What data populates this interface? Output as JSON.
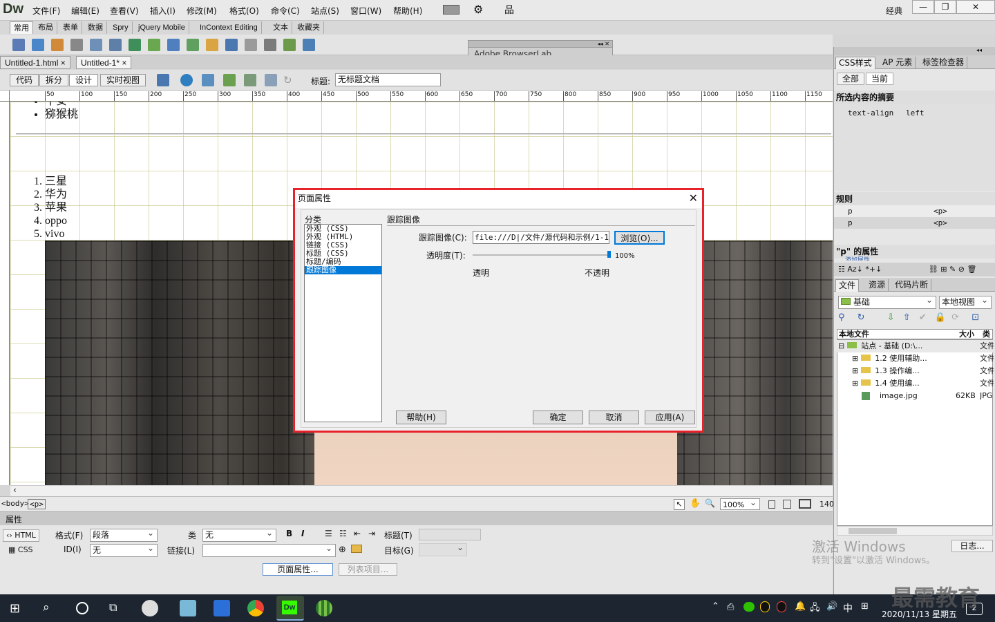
{
  "app": {
    "logo": "Dw"
  },
  "menu": [
    "文件(F)",
    "编辑(E)",
    "查看(V)",
    "插入(I)",
    "修改(M)",
    "格式(O)",
    "命令(C)",
    "站点(S)",
    "窗口(W)",
    "帮助(H)"
  ],
  "workspace": "经典",
  "window_controls": {
    "minimize": "—",
    "restore": "❐",
    "close": "✕"
  },
  "insert_tabs": [
    "常用",
    "布局",
    "表单",
    "数据",
    "Spry",
    "jQuery Mobile",
    "InContext Editing",
    "文本",
    "收藏夹"
  ],
  "browserlab": {
    "title": "Adobe BrowserLab"
  },
  "doc_tabs": [
    {
      "label": "Untitled-1.html"
    },
    {
      "label": "Untitled-1*"
    }
  ],
  "tab_close": "×",
  "view_buttons": [
    "代码",
    "拆分",
    "设计",
    "实时视图"
  ],
  "doc_title": {
    "label": "标题:",
    "value": "无标题文档"
  },
  "ruler_ticks": [
    "50",
    "100",
    "150",
    "200",
    "250",
    "300",
    "350",
    "400",
    "450",
    "500",
    "550",
    "600",
    "650",
    "700",
    "750",
    "800",
    "850",
    "900",
    "950",
    "1000",
    "1050",
    "1100",
    "1150"
  ],
  "canvas": {
    "ul_items": [
      "平安",
      "猕猴桃"
    ],
    "ol_items": [
      "三星",
      "华为",
      "苹果",
      "oppo",
      "vivo"
    ]
  },
  "statusbar": {
    "tags": [
      "<body>",
      "<p>"
    ],
    "zoom": "100%",
    "size": "140"
  },
  "properties": {
    "title": "属性",
    "html_btn": "HTML",
    "css_btn": "CSS",
    "format_label": "格式(F)",
    "format_value": "段落",
    "class_label": "类",
    "class_value": "无",
    "id_label": "ID(I)",
    "id_value": "无",
    "link_label": "链接(L)",
    "title_label": "标题(T)",
    "target_label": "目标(G)",
    "bold": "B",
    "italic": "I",
    "page_props_btn": "页面属性...",
    "list_item_btn": "列表项目..."
  },
  "right_panel": {
    "tabs1": [
      "CSS样式",
      "AP 元素",
      "标签检查器"
    ],
    "mode_tabs": [
      "全部",
      "当前"
    ],
    "summary_title": "所选内容的摘要",
    "summary_prop": "text-align",
    "summary_value": "left",
    "rules_title": "规则",
    "rules": [
      {
        "sel": "p",
        "tag": "<p>"
      },
      {
        "sel": "p",
        "tag": "<p>"
      }
    ],
    "props_title": "\"p\" 的属性",
    "add_prop": "添加属性",
    "tabs2": [
      "文件",
      "资源",
      "代码片断"
    ],
    "site": "基础",
    "view": "本地视图",
    "cols": [
      "本地文件",
      "大小",
      "类型"
    ],
    "files": [
      {
        "name": "站点 - 基础 (D:\\...",
        "size": "",
        "type": "文件"
      },
      {
        "name": "1.2 使用辅助...",
        "size": "",
        "type": "文件"
      },
      {
        "name": "1.3  操作编...",
        "size": "",
        "type": "文件"
      },
      {
        "name": "1.4  使用编...",
        "size": "",
        "type": "文件"
      },
      {
        "name": "image.jpg",
        "size": "62KB",
        "type": "JPG"
      }
    ],
    "log_btn": "日志..."
  },
  "dialog": {
    "title": "页面属性",
    "category_label": "分类",
    "categories": [
      "外观 (CSS)",
      "外观 (HTML)",
      "链接 (CSS)",
      "标题 (CSS)",
      "标题/编码",
      "跟踪图像"
    ],
    "section_title": "跟踪图像",
    "image_label": "跟踪图像(C):",
    "image_value": "file:///D|/文件/源代码和示例/1-1",
    "browse_btn": "浏览(O)...",
    "opacity_label": "透明度(T):",
    "opacity_value": "100%",
    "opacity_level": 1.0,
    "transparent": "透明",
    "opaque": "不透明",
    "help_btn": "帮助(H)",
    "ok_btn": "确定",
    "cancel_btn": "取消",
    "apply_btn": "应用(A)"
  },
  "watermark": {
    "line1": "激活 Windows",
    "line2": "转到\"设置\"以激活 Windows。"
  },
  "brand": "最需教育",
  "taskbar": {
    "ime": "中",
    "date": "2020/11/13 星期五",
    "notif": "2"
  }
}
